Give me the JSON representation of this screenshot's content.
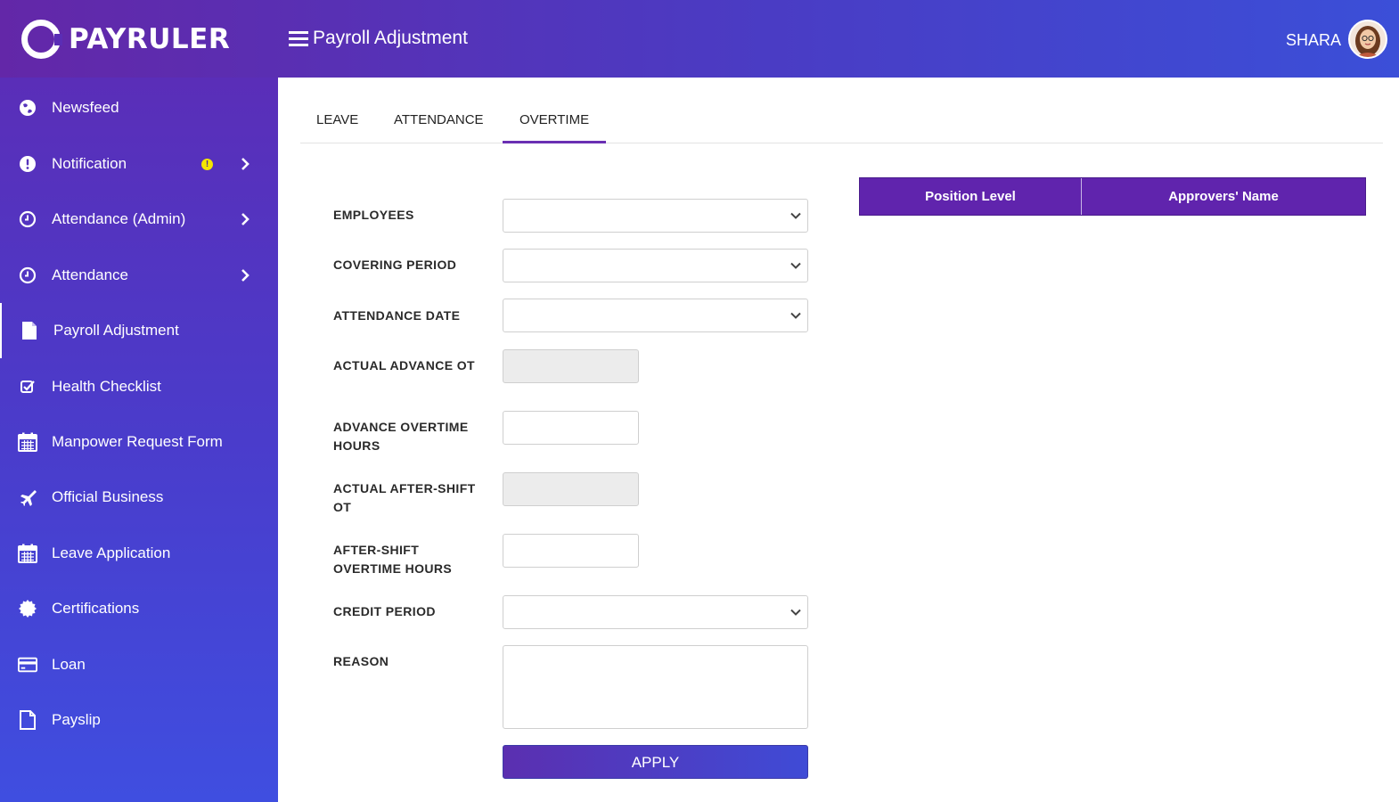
{
  "header": {
    "brand": "PAYRULER",
    "page_title": "Payroll Adjustment",
    "user_name": "SHARA"
  },
  "sidebar": {
    "items": [
      {
        "label": "Newsfeed",
        "icon": "globe-icon"
      },
      {
        "label": "Notification",
        "icon": "exclamation-circle-icon",
        "badge": "!"
      },
      {
        "label": "Attendance (Admin)",
        "icon": "clock-icon"
      },
      {
        "label": "Attendance",
        "icon": "clock-icon"
      },
      {
        "label": "Payroll Adjustment",
        "icon": "file-icon"
      },
      {
        "label": "Health Checklist",
        "icon": "checkbox-icon"
      },
      {
        "label": "Manpower Request Form",
        "icon": "calendar-icon"
      },
      {
        "label": "Official Business",
        "icon": "airplane-icon"
      },
      {
        "label": "Leave Application",
        "icon": "calendar-icon"
      },
      {
        "label": "Certifications",
        "icon": "certificate-icon"
      },
      {
        "label": "Loan",
        "icon": "credit-card-icon"
      },
      {
        "label": "Payslip",
        "icon": "file-outline-icon"
      }
    ]
  },
  "tabs": [
    {
      "label": "LEAVE"
    },
    {
      "label": "ATTENDANCE"
    },
    {
      "label": "OVERTIME",
      "active": true
    }
  ],
  "form": {
    "employees_label": "EMPLOYEES",
    "covering_period_label": "COVERING PERIOD",
    "attendance_date_label": "ATTENDANCE DATE",
    "actual_advance_ot_label": "ACTUAL ADVANCE OT",
    "advance_overtime_hours_label": "ADVANCE OVERTIME HOURS",
    "actual_after_shift_ot_label": "ACTUAL AFTER-SHIFT OT",
    "after_shift_overtime_hours_label": "AFTER-SHIFT OVERTIME HOURS",
    "credit_period_label": "CREDIT PERIOD",
    "reason_label": "REASON",
    "apply_label": "APPLY"
  },
  "approvers_table": {
    "columns": [
      "Position Level",
      "Approvers' Name"
    ]
  },
  "colors": {
    "header_start": "#6327a8",
    "header_end": "#3b4fd8",
    "accent": "#6024ad",
    "badge": "#f5e600"
  }
}
